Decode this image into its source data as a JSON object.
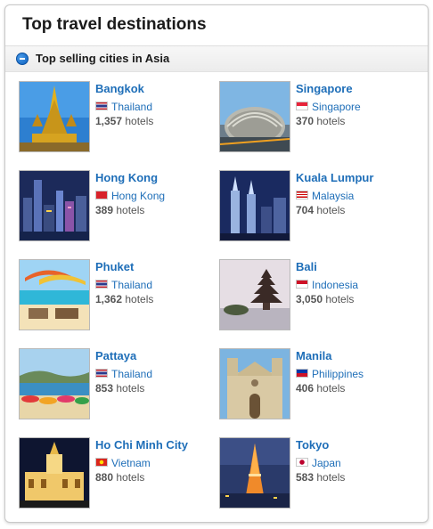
{
  "widget": {
    "title": "Top travel destinations",
    "section_title": "Top selling cities in Asia",
    "hotels_word": "hotels"
  },
  "cities": [
    {
      "name": "Bangkok",
      "country": "Thailand",
      "hotels": "1,357",
      "flag": "thailand-flag-icon"
    },
    {
      "name": "Singapore",
      "country": "Singapore",
      "hotels": "370",
      "flag": "singapore-flag-icon"
    },
    {
      "name": "Hong Kong",
      "country": "Hong Kong",
      "hotels": "389",
      "flag": "hong-kong-flag-icon"
    },
    {
      "name": "Kuala Lumpur",
      "country": "Malaysia",
      "hotels": "704",
      "flag": "malaysia-flag-icon"
    },
    {
      "name": "Phuket",
      "country": "Thailand",
      "hotels": "1,362",
      "flag": "thailand-flag-icon"
    },
    {
      "name": "Bali",
      "country": "Indonesia",
      "hotels": "3,050",
      "flag": "indonesia-flag-icon"
    },
    {
      "name": "Pattaya",
      "country": "Thailand",
      "hotels": "853",
      "flag": "thailand-flag-icon"
    },
    {
      "name": "Manila",
      "country": "Philippines",
      "hotels": "406",
      "flag": "philippines-flag-icon"
    },
    {
      "name": "Ho Chi Minh City",
      "country": "Vietnam",
      "hotels": "880",
      "flag": "vietnam-flag-icon"
    },
    {
      "name": "Tokyo",
      "country": "Japan",
      "hotels": "583",
      "flag": "japan-flag-icon"
    }
  ],
  "colors": {
    "link": "#1e6eb8",
    "hotel_text": "#555555",
    "collapse_icon": "#0b5fbf"
  }
}
